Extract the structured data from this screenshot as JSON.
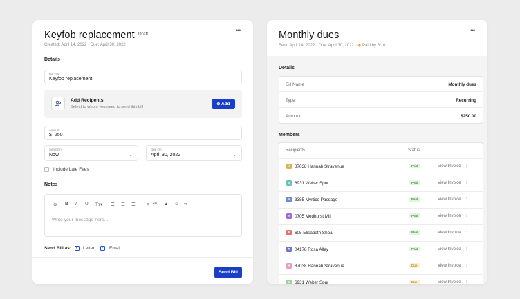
{
  "bill_form": {
    "title": "Keyfob replacement",
    "status": "Draft",
    "more": "•••",
    "created": "Created: April 14, 2022",
    "due": "Due: April 30, 2022",
    "details_heading": "Details",
    "bill_title": {
      "label": "Bill Title",
      "value": "Keyfob replacement"
    },
    "recipients": {
      "icon": "users-icon",
      "title": "Add Recipents",
      "subtitle": "Select to whom you need to send this bill",
      "add_icon": "plus-circle-icon",
      "add_label": "Add"
    },
    "amount": {
      "label": "Amount",
      "currency": "$",
      "value": "250"
    },
    "send_on": {
      "label": "Send On",
      "value": "Now"
    },
    "due_on": {
      "label": "Due On",
      "value": "April 30, 2022"
    },
    "late_fees_label": "Include Late Fees",
    "notes_heading": "Notes",
    "editor_placeholder": "Write your message here...",
    "toolbar": [
      "add-icon",
      "bold-icon",
      "italic-icon",
      "underline-icon",
      "text-size-icon",
      "align-left-icon",
      "align-center-icon",
      "align-right-icon",
      "ordered-list-icon",
      "bullet-list-icon",
      "image-icon",
      "emoji-icon",
      "link-icon"
    ],
    "send_as_label": "Send Bill as:",
    "send_as_letter": "Letter",
    "send_as_email": "Email",
    "send_button": "Send Bill"
  },
  "bill_view": {
    "title": "Monthly dues",
    "more": "•••",
    "sent": "Sent: April 14, 2022",
    "due": "Due: April 30, 2022",
    "paid_by": "Paid by 6/10",
    "details_heading": "Details",
    "details": [
      {
        "key": "Bill Name",
        "value": "Monthly dues"
      },
      {
        "key": "Type",
        "value": "Recurring"
      },
      {
        "key": "Amount",
        "value": "$250.00"
      }
    ],
    "members_heading": "Members",
    "columns": {
      "recipients": "Recipients",
      "status": "Status"
    },
    "members": [
      {
        "initial": "H",
        "color": "#d9b25a",
        "name": "87038 Hannah Stravenue",
        "status": "Paid",
        "action": "View Invoice"
      },
      {
        "initial": "W",
        "color": "#6ac3b0",
        "name": "6931 Weber Spur",
        "status": "Paid",
        "action": "View Invoice"
      },
      {
        "initial": "M",
        "color": "#6b8fd6",
        "name": "3385 Myrtice Passage",
        "status": "Paid",
        "action": "View Invoice"
      },
      {
        "initial": "M",
        "color": "#9b6bd6",
        "name": "0705 Medhurst Mill",
        "status": "Paid",
        "action": "View Invoice"
      },
      {
        "initial": "E",
        "color": "#e2736d",
        "name": "605 Elisabeth Shoal",
        "status": "Paid",
        "action": "View Invoice"
      },
      {
        "initial": "R",
        "color": "#6f77c9",
        "name": "04178 Rosa Alley",
        "status": "Paid",
        "action": "View Invoice"
      },
      {
        "initial": "H",
        "color": "#e89cc0",
        "name": "87038 Hannah Stravenue",
        "status": "Due",
        "action": "View Invoice"
      },
      {
        "initial": "W",
        "color": "#9fd29a",
        "name": "6931 Weber Spur",
        "status": "Due",
        "action": "View Invoice"
      }
    ]
  }
}
